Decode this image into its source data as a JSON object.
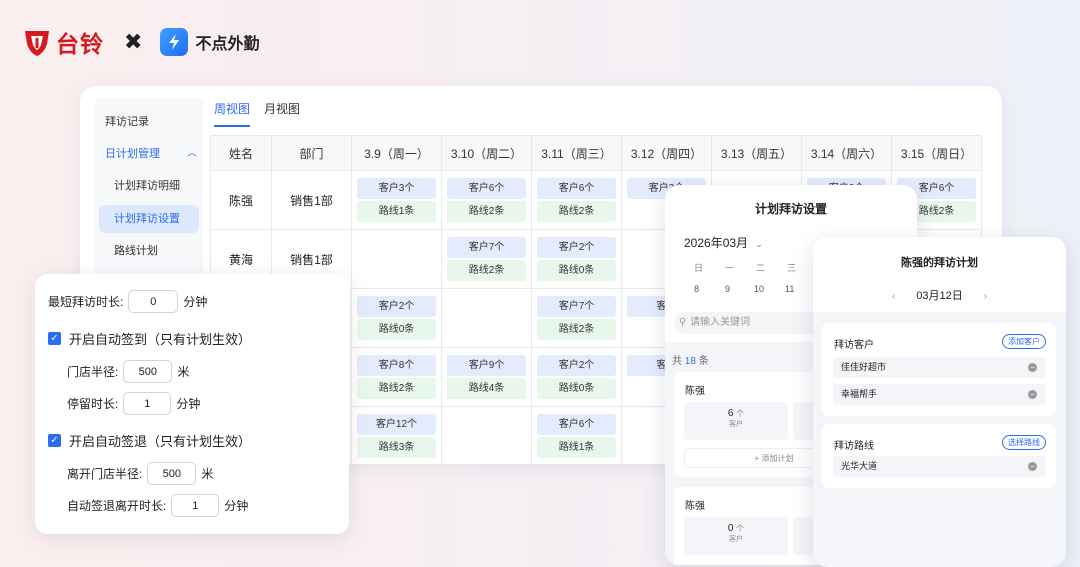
{
  "brand": {
    "tailg": "台铃",
    "times": "✖",
    "partner": "不点外勤",
    "partner_icon": "bolt-icon"
  },
  "main": {
    "sidebar": [
      {
        "label": "拜访记录"
      },
      {
        "label": "日计划管理"
      },
      {
        "label": "计划拜访明细"
      },
      {
        "label": "计划拜访设置"
      },
      {
        "label": "路线计划"
      }
    ],
    "tabs": [
      {
        "label": "周视图"
      },
      {
        "label": "月视图"
      }
    ],
    "table": {
      "headers": [
        "姓名",
        "部门",
        "3.9（周一）",
        "3.10（周二）",
        "3.11（周三）",
        "3.12（周四）",
        "3.13（周五）",
        "3.14（周六）",
        "3.15（周日）"
      ],
      "rows": [
        {
          "name": "陈强",
          "dept": "销售1部",
          "cells": [
            [
              "客户3个",
              "路线1条"
            ],
            [
              "客户6个",
              "路线2条"
            ],
            [
              "客户6个",
              "路线2条"
            ],
            [
              "客户3个",
              ""
            ],
            [],
            [
              "客户2个",
              ""
            ],
            [
              "客户6个",
              "路线2条"
            ]
          ]
        },
        {
          "name": "黄海",
          "dept": "销售1部",
          "cells": [
            [],
            [
              "客户7个",
              "路线2条"
            ],
            [
              "客户2个",
              "路线0条"
            ],
            [],
            [],
            [],
            []
          ]
        },
        {
          "name": "",
          "dept": "",
          "cells": [
            [
              "客户2个",
              "路线0条"
            ],
            [],
            [
              "客户7个",
              "路线2条"
            ],
            [
              "客户",
              ""
            ],
            [],
            [],
            []
          ]
        },
        {
          "name": "",
          "dept": "",
          "cells": [
            [
              "客户8个",
              "路线2条"
            ],
            [
              "客户9个",
              "路线4条"
            ],
            [
              "客户2个",
              "路线0条"
            ],
            [
              "客户",
              ""
            ],
            [],
            [],
            []
          ]
        },
        {
          "name": "",
          "dept": "",
          "cells": [
            [
              "客户12个",
              "路线3条"
            ],
            [],
            [
              "客户6个",
              "路线1条"
            ],
            [],
            [],
            [],
            []
          ]
        }
      ]
    }
  },
  "settings": {
    "min_visit_label": "最短拜访时长:",
    "min_visit_value": "0",
    "min_visit_unit": "分钟",
    "auto_checkin_label": "开启自动签到（只有计划生效）",
    "radius_label": "门店半径:",
    "radius_value": "500",
    "radius_unit": "米",
    "stay_label": "停留时长:",
    "stay_value": "1",
    "stay_unit": "分钟",
    "auto_checkout_label": "开启自动签退（只有计划生效）",
    "leave_radius_label": "离开门店半径:",
    "leave_radius_value": "500",
    "leave_radius_unit": "米",
    "leave_time_label": "自动签退离开时长:",
    "leave_time_value": "1",
    "leave_time_unit": "分钟",
    "check_mark": "✓"
  },
  "phone1": {
    "title": "计划拜访设置",
    "month": "2026年03月",
    "month_chev": "⌄",
    "weekdays": [
      "日",
      "一",
      "二",
      "三"
    ],
    "days": [
      "8",
      "9",
      "10",
      "11"
    ],
    "search_placeholder": "请输入关键词",
    "count_prefix": "共",
    "count_value": "18",
    "count_suffix": "条",
    "cards": [
      {
        "name": "陈强",
        "num": "6",
        "unit": "个",
        "label": "客户",
        "add": "+ 添加计划"
      },
      {
        "name": "陈强",
        "num": "0",
        "unit": "个",
        "label": "客户"
      }
    ]
  },
  "phone2": {
    "title": "陈强的拜访计划",
    "date": "03月12日",
    "prev": "‹",
    "next": "›",
    "visit_customer_title": "拜访客户",
    "add_customer": "添加客户",
    "customers": [
      "佳佳好超市",
      "幸福帮手"
    ],
    "visit_route_title": "拜访路线",
    "select_route": "选择路线",
    "routes": [
      "光华大道"
    ],
    "minus": "−"
  },
  "colors": {
    "accent": "#2b6df0",
    "brand_red": "#d7191f"
  }
}
